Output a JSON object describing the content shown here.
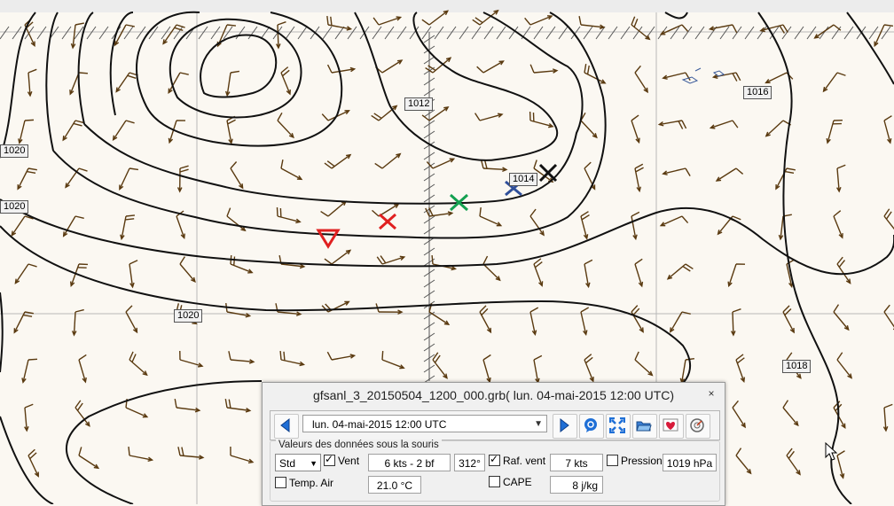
{
  "map": {
    "isobar_labels": [
      "1012",
      "1014",
      "1016",
      "1018",
      "1020",
      "1020",
      "1020",
      "1020"
    ]
  },
  "panel": {
    "title": "gfsanl_3_20150504_1200_000.grb( lun. 04-mai-2015 12:00  UTC)",
    "close_icon": "×",
    "toolbar": {
      "date_selected": "lun. 04-mai-2015 12:00  UTC",
      "icons": [
        "prev-arrow-icon",
        "next-arrow-icon",
        "chat-bubble-icon",
        "fullscreen-icon",
        "open-folder-icon",
        "favorites-icon",
        "settings-gauge-icon"
      ]
    },
    "values": {
      "group_title": "Valeurs des données sous la souris",
      "std_select": "Std",
      "wind_label": "Vent",
      "wind_value": "6 kts -  2 bf",
      "wind_dir": "312°",
      "gust_label": "Raf. vent",
      "gust_value": "7 kts",
      "pressure_label": "Pression",
      "pressure_value": "1019 hPa",
      "air_temp_label": "Temp. Air",
      "air_temp_value": "21.0 °C",
      "cape_label": "CAPE",
      "cape_value": "8 j/kg"
    }
  },
  "colors": {
    "map_bg": "#fbf8f2",
    "barb": "#5a3a10",
    "isobar": "#111111",
    "grid": "#b8b8b8",
    "marker_red": "#e02020",
    "marker_green": "#13a050",
    "marker_blue": "#2f4f9a",
    "marker_black": "#111111"
  }
}
